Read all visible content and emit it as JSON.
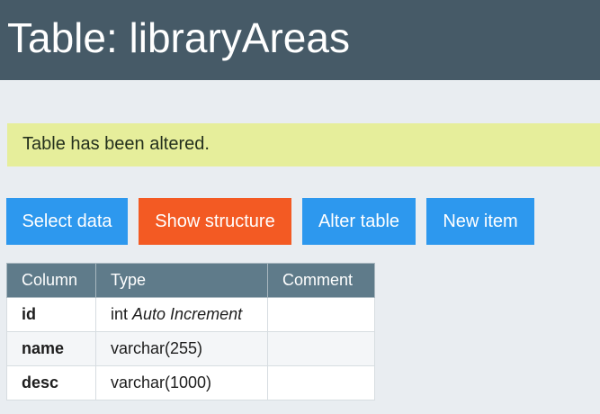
{
  "header": {
    "title": "Table: libraryAreas"
  },
  "message": {
    "text": "Table has been altered."
  },
  "toolbar": {
    "buttons": [
      {
        "label": "Select data"
      },
      {
        "label": "Show structure"
      },
      {
        "label": "Alter table"
      },
      {
        "label": "New item"
      }
    ]
  },
  "structure_table": {
    "headers": {
      "column": "Column",
      "type": "Type",
      "comment": "Comment"
    },
    "rows": [
      {
        "column": "id",
        "type": "int",
        "extra": "Auto Increment",
        "comment": ""
      },
      {
        "column": "name",
        "type": "varchar(255)",
        "extra": "",
        "comment": ""
      },
      {
        "column": "desc",
        "type": "varchar(1000)",
        "extra": "",
        "comment": ""
      }
    ]
  },
  "colors": {
    "header_background": "#465a67",
    "message_background": "#e6ee9b",
    "primary_button": "#2d98ee",
    "active_button": "#f35a23",
    "table_header": "#5f7b8a"
  }
}
